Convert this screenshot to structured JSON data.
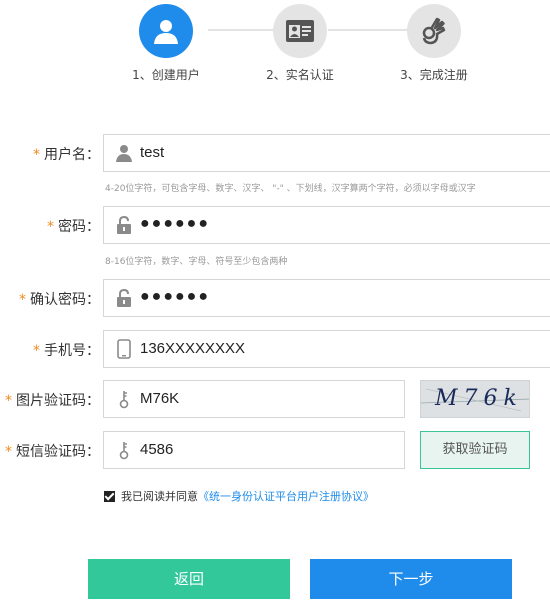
{
  "steps": [
    {
      "label": "1、创建用户",
      "icon": "user-icon",
      "active": true
    },
    {
      "label": "2、实名认证",
      "icon": "id-card-icon",
      "active": false
    },
    {
      "label": "3、完成注册",
      "icon": "ok-hand-icon",
      "active": false
    }
  ],
  "form": {
    "required_mark": "*",
    "username": {
      "label": "用户名：",
      "value": "test",
      "hint": "4-20位字符，可包含字母、数字、汉字、 \"-\" 、下划线，汉字算两个字符，必须以字母或汉字"
    },
    "password": {
      "label": "密码：",
      "value": "●●●●●●",
      "hint": "8-16位字符，数字、字母、符号至少包含两种"
    },
    "confirm_password": {
      "label": "确认密码：",
      "value": "●●●●●●"
    },
    "phone": {
      "label": "手机号：",
      "value": "136XXXXXXXX"
    },
    "image_captcha": {
      "label": "图片验证码：",
      "value": "M76K",
      "captcha_text": "M76k"
    },
    "sms_code": {
      "label": "短信验证码：",
      "value": "4586",
      "button_label": "获取验证码"
    }
  },
  "agreement": {
    "prefix": "我已阅读并同意",
    "link": "《统一身份认证平台用户注册协议》",
    "checked": true
  },
  "buttons": {
    "back": "返回",
    "next": "下一步"
  },
  "colors": {
    "primary": "#1f8ceb",
    "green": "#33c89a",
    "required": "#f08a1d"
  }
}
